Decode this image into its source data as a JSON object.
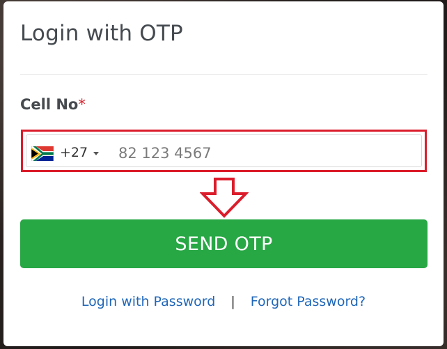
{
  "form": {
    "title": "Login with OTP",
    "cell_label": "Cell No",
    "required_marker": "*",
    "country_code": "+27",
    "country_flag": "south-africa-flag-icon",
    "phone_placeholder": "82 123 4567",
    "phone_value": "",
    "send_button_label": "SEND OTP"
  },
  "links": {
    "login_with_password": "Login with Password",
    "separator": "|",
    "forgot_password": "Forgot Password?"
  },
  "colors": {
    "send_button": "#28a745",
    "link": "#1f66b8",
    "highlight": "#db1d2b",
    "required": "#d9262f"
  }
}
